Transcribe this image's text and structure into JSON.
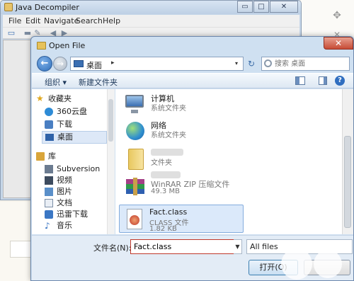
{
  "java_decompiler": {
    "title": "Java Decompiler",
    "caption": {
      "minimize": "▭",
      "maximize": "□",
      "close": "✕"
    },
    "menu": [
      "File",
      "Edit",
      "Navigate",
      "Search",
      "Help"
    ]
  },
  "open_dialog": {
    "title": "Open File",
    "address": {
      "location": "桌面",
      "separator": "▸",
      "dropdown": "▾"
    },
    "search_placeholder": "搜索 桌面",
    "toolbar": {
      "organize": "组织 ▾",
      "new_folder": "新建文件夹",
      "help": "?"
    },
    "nav": {
      "favorites_header": "收藏夹",
      "favorites": [
        "360云盘",
        "下载",
        "桌面"
      ],
      "library_header": "库",
      "libraries": [
        "Subversion",
        "视频",
        "图片",
        "文档",
        "迅雷下载",
        "音乐"
      ]
    },
    "files": [
      {
        "name": "计算机",
        "type": "系统文件夹",
        "size": ""
      },
      {
        "name": "网络",
        "type": "系统文件夹",
        "size": ""
      },
      {
        "name": "",
        "type": "文件夹",
        "size": ""
      },
      {
        "name": "",
        "type": "WinRAR ZIP 压缩文件",
        "size": "49.3 MB"
      },
      {
        "name": "Fact.class",
        "type": "CLASS 文件",
        "size": "1.82 KB"
      }
    ],
    "filename_label": "文件名(N):",
    "filename_value": "Fact.class",
    "filetype_value": "All files",
    "open_button": "打开(O)"
  }
}
